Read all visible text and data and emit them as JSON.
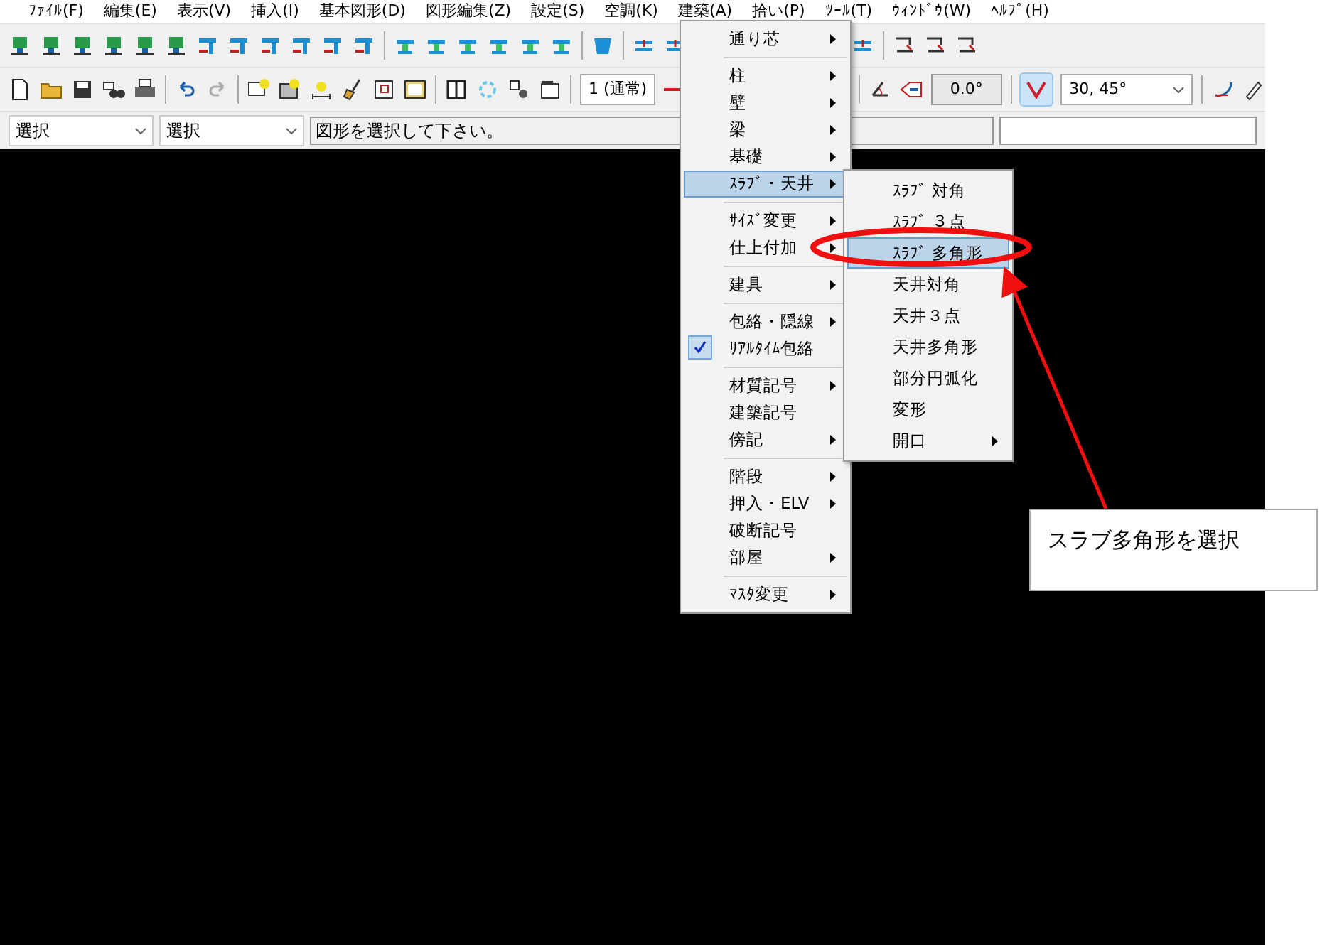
{
  "menubar": [
    "ﾌｧｲﾙ(F)",
    "編集(E)",
    "表示(V)",
    "挿入(I)",
    "基本図形(D)",
    "図形編集(Z)",
    "設定(S)",
    "空調(K)",
    "建築(A)",
    "拾い(P)",
    "ﾂｰﾙ(T)",
    "ｳｨﾝﾄﾞｳ(W)",
    "ﾍﾙﾌﾟ(H)"
  ],
  "toolbar_row_2": {
    "line_style": "1 (通常)",
    "angle": "0.0°",
    "snap_toggle_on": true,
    "snap_angles": "30, 45°"
  },
  "selector_row": {
    "mode_1": "選択",
    "mode_2": "選択",
    "message": "図形を選択して下さい。"
  },
  "menu": {
    "items": [
      {
        "label": "通り芯",
        "submenu": true,
        "checked": false,
        "selected": false,
        "separator_after": true
      },
      {
        "label": "柱",
        "submenu": true,
        "checked": false,
        "selected": false,
        "separator_after": false
      },
      {
        "label": "壁",
        "submenu": true,
        "checked": false,
        "selected": false,
        "separator_after": false
      },
      {
        "label": "梁",
        "submenu": true,
        "checked": false,
        "selected": false,
        "separator_after": false
      },
      {
        "label": "基礎",
        "submenu": true,
        "checked": false,
        "selected": false,
        "separator_after": false
      },
      {
        "label": "ｽﾗﾌﾞ・天井",
        "submenu": true,
        "checked": false,
        "selected": true,
        "separator_after": true
      },
      {
        "label": "ｻｲｽﾞ変更",
        "submenu": true,
        "checked": false,
        "selected": false,
        "separator_after": false
      },
      {
        "label": "仕上付加",
        "submenu": true,
        "checked": false,
        "selected": false,
        "separator_after": true
      },
      {
        "label": "建具",
        "submenu": true,
        "checked": false,
        "selected": false,
        "separator_after": true
      },
      {
        "label": "包絡・隠線",
        "submenu": true,
        "checked": false,
        "selected": false,
        "separator_after": false
      },
      {
        "label": "ﾘｱﾙﾀｲﾑ包絡",
        "submenu": false,
        "checked": true,
        "selected": false,
        "separator_after": true
      },
      {
        "label": "材質記号",
        "submenu": true,
        "checked": false,
        "selected": false,
        "separator_after": false
      },
      {
        "label": "建築記号",
        "submenu": false,
        "checked": false,
        "selected": false,
        "separator_after": false
      },
      {
        "label": "傍記",
        "submenu": true,
        "checked": false,
        "selected": false,
        "separator_after": true
      },
      {
        "label": "階段",
        "submenu": true,
        "checked": false,
        "selected": false,
        "separator_after": false
      },
      {
        "label": "押入・ELV",
        "submenu": true,
        "checked": false,
        "selected": false,
        "separator_after": false
      },
      {
        "label": "破断記号",
        "submenu": false,
        "checked": false,
        "selected": false,
        "separator_after": false
      },
      {
        "label": "部屋",
        "submenu": true,
        "checked": false,
        "selected": false,
        "separator_after": true
      },
      {
        "label": "ﾏｽﾀ変更",
        "submenu": true,
        "checked": false,
        "selected": false,
        "separator_after": false
      }
    ]
  },
  "submenu": {
    "items": [
      {
        "label": "ｽﾗﾌﾞ 対角",
        "submenu": false,
        "selected": false
      },
      {
        "label": "ｽﾗﾌﾞ ３点",
        "submenu": false,
        "selected": false
      },
      {
        "label": "ｽﾗﾌﾞ 多角形",
        "submenu": false,
        "selected": true
      },
      {
        "label": "天井対角",
        "submenu": false,
        "selected": false
      },
      {
        "label": "天井３点",
        "submenu": false,
        "selected": false
      },
      {
        "label": "天井多角形",
        "submenu": false,
        "selected": false
      },
      {
        "label": "部分円弧化",
        "submenu": false,
        "selected": false
      },
      {
        "label": "変形",
        "submenu": false,
        "selected": false
      },
      {
        "label": "開口",
        "submenu": true,
        "selected": false
      }
    ]
  },
  "callout": {
    "text": "スラブ多角形を選択"
  }
}
